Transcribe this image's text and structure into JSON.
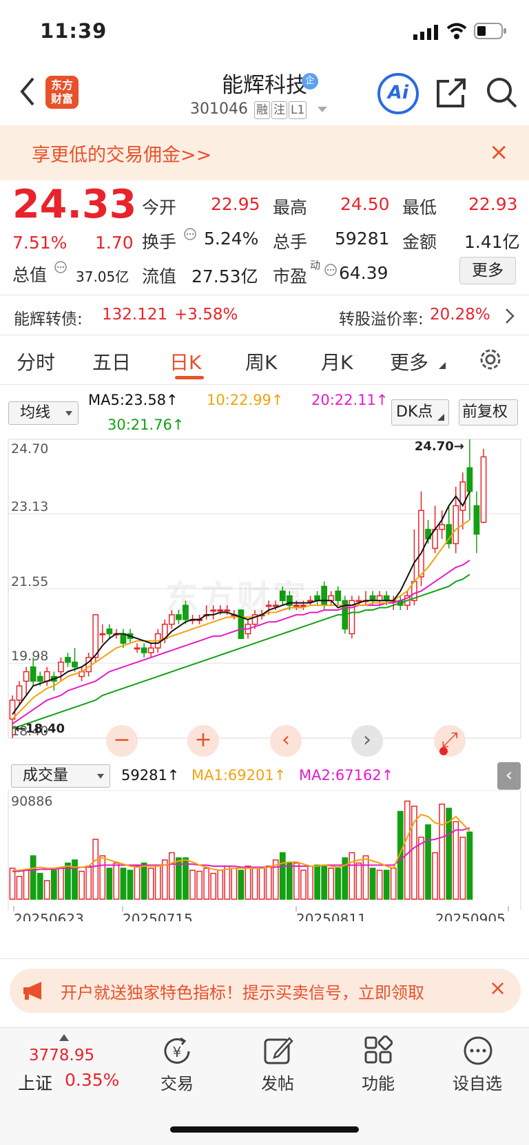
{
  "status": {
    "time": "11:39"
  },
  "nav": {
    "logo_line1": "东方",
    "logo_line2": "财富",
    "stock_name": "能辉科技",
    "badge": "企",
    "code": "301046",
    "tags": [
      "融",
      "注",
      "L1"
    ],
    "ai_label": "Ai"
  },
  "promo": {
    "text": "享更低的交易佣金>>",
    "close": "×"
  },
  "quote": {
    "price": "24.33",
    "change_pct": "7.51%",
    "change": "1.70",
    "open_label": "今开",
    "open": "22.95",
    "high_label": "最高",
    "high": "24.50",
    "low_label": "最低",
    "low": "22.93",
    "turnover_label": "换手",
    "turnover": "5.24%",
    "volume_label": "总手",
    "volume": "59281",
    "amount_label": "金额",
    "amount": "1.41亿",
    "mktcap_label": "总值",
    "mktcap": "37.05亿",
    "float_label": "流值",
    "float": "27.53亿",
    "pe_label": "市盈",
    "pe_sup": "动",
    "pe": "64.39",
    "more": "更多"
  },
  "bond": {
    "label": "能辉转债:",
    "price": "132.121",
    "change": "+3.58%",
    "premium_label": "转股溢价率:",
    "premium": "20.28%"
  },
  "tabs": [
    "分时",
    "五日",
    "日K",
    "周K",
    "月K",
    "更多"
  ],
  "ma_bar": {
    "selector": "均线",
    "ma5": "MA5:23.58↑",
    "ma10": "10:22.99↑",
    "ma20": "20:22.11↑",
    "ma30": "30:21.76↑",
    "dk": "DK点",
    "adjust": "前复权"
  },
  "kline": {
    "y_labels": [
      "24.70",
      "23.13",
      "21.55",
      "19.98",
      "18.40"
    ],
    "max_tag": "24.70→",
    "min_tag": "←18.40",
    "watermark": "东方财富"
  },
  "volume_bar": {
    "selector": "成交量",
    "vol": "59281↑",
    "ma1": "MA1:69201↑",
    "ma2": "MA2:67162↑",
    "max": "90886"
  },
  "dates": [
    "20250623",
    "20250715",
    "20250811",
    "20250905"
  ],
  "banner": {
    "text": "开户就送独家特色指标！提示买卖信号，立即领取",
    "close": "×"
  },
  "bottom": {
    "index_value": "3778.95",
    "index_name": "上证",
    "index_change": "0.35%",
    "items": [
      "交易",
      "发帖",
      "功能",
      "设自选"
    ]
  },
  "colors": {
    "up": "#e8232b",
    "down": "#13a013",
    "accent": "#e8512b",
    "ma5": "#111111",
    "ma10": "#f2a20d",
    "ma20": "#e31bc9",
    "ma30": "#13a013"
  },
  "chart_data": {
    "type": "candlestick",
    "price_range": [
      18.4,
      24.7
    ],
    "volume_max": 90886,
    "candles": [
      {
        "o": 18.8,
        "c": 19.2,
        "h": 19.3,
        "l": 18.4
      },
      {
        "o": 19.2,
        "c": 19.5,
        "h": 19.6,
        "l": 19.1
      },
      {
        "o": 19.6,
        "c": 19.8,
        "h": 19.9,
        "l": 19.3
      },
      {
        "o": 19.9,
        "c": 19.6,
        "h": 20.1,
        "l": 19.5
      },
      {
        "o": 19.7,
        "c": 19.6,
        "h": 19.8,
        "l": 19.5
      },
      {
        "o": 19.6,
        "c": 19.8,
        "h": 19.9,
        "l": 19.5
      },
      {
        "o": 19.7,
        "c": 19.6,
        "h": 19.8,
        "l": 19.4
      },
      {
        "o": 19.8,
        "c": 20.0,
        "h": 20.1,
        "l": 19.6
      },
      {
        "o": 20.1,
        "c": 20.0,
        "h": 20.2,
        "l": 19.9
      },
      {
        "o": 20.0,
        "c": 19.9,
        "h": 20.3,
        "l": 19.8
      },
      {
        "o": 19.7,
        "c": 19.8,
        "h": 19.9,
        "l": 19.6
      },
      {
        "o": 19.8,
        "c": 20.1,
        "h": 20.2,
        "l": 19.7
      },
      {
        "o": 20.1,
        "c": 21.0,
        "h": 21.0,
        "l": 20.0
      },
      {
        "o": 20.6,
        "c": 20.6,
        "h": 20.8,
        "l": 20.4
      },
      {
        "o": 20.7,
        "c": 20.6,
        "h": 20.8,
        "l": 20.5
      },
      {
        "o": 20.6,
        "c": 20.6,
        "h": 20.7,
        "l": 20.5
      },
      {
        "o": 20.6,
        "c": 20.4,
        "h": 20.7,
        "l": 20.3
      },
      {
        "o": 20.6,
        "c": 20.5,
        "h": 20.7,
        "l": 20.4
      },
      {
        "o": 20.3,
        "c": 20.3,
        "h": 20.4,
        "l": 20.2
      },
      {
        "o": 20.3,
        "c": 20.2,
        "h": 20.4,
        "l": 20.1
      },
      {
        "o": 20.2,
        "c": 20.3,
        "h": 20.4,
        "l": 20.1
      },
      {
        "o": 20.3,
        "c": 20.6,
        "h": 20.7,
        "l": 20.2
      },
      {
        "o": 20.5,
        "c": 20.8,
        "h": 20.9,
        "l": 20.4
      },
      {
        "o": 20.8,
        "c": 21.0,
        "h": 21.1,
        "l": 20.7
      },
      {
        "o": 21.0,
        "c": 20.9,
        "h": 21.1,
        "l": 20.8
      },
      {
        "o": 21.2,
        "c": 20.9,
        "h": 21.3,
        "l": 20.8
      },
      {
        "o": 20.9,
        "c": 20.9,
        "h": 21.0,
        "l": 20.8
      },
      {
        "o": 20.9,
        "c": 20.9,
        "h": 21.0,
        "l": 20.8
      },
      {
        "o": 21.0,
        "c": 21.0,
        "h": 21.2,
        "l": 20.9
      },
      {
        "o": 21.1,
        "c": 21.1,
        "h": 21.2,
        "l": 20.9
      },
      {
        "o": 21.1,
        "c": 21.1,
        "h": 21.2,
        "l": 21.0
      },
      {
        "o": 21.1,
        "c": 21.1,
        "h": 21.2,
        "l": 21.0
      },
      {
        "o": 21.0,
        "c": 21.0,
        "h": 21.1,
        "l": 20.9
      },
      {
        "o": 21.1,
        "c": 20.5,
        "h": 21.1,
        "l": 20.5
      },
      {
        "o": 20.6,
        "c": 20.8,
        "h": 20.9,
        "l": 20.5
      },
      {
        "o": 20.8,
        "c": 21.0,
        "h": 21.1,
        "l": 20.7
      },
      {
        "o": 21.0,
        "c": 21.0,
        "h": 21.1,
        "l": 20.9
      },
      {
        "o": 21.2,
        "c": 21.2,
        "h": 21.3,
        "l": 21.0
      },
      {
        "o": 21.2,
        "c": 21.2,
        "h": 21.3,
        "l": 21.1
      },
      {
        "o": 21.5,
        "c": 21.3,
        "h": 21.6,
        "l": 21.2
      },
      {
        "o": 21.4,
        "c": 21.2,
        "h": 21.5,
        "l": 21.1
      },
      {
        "o": 21.2,
        "c": 21.2,
        "h": 21.3,
        "l": 21.1
      },
      {
        "o": 21.2,
        "c": 21.2,
        "h": 21.3,
        "l": 21.1
      },
      {
        "o": 21.3,
        "c": 21.3,
        "h": 21.4,
        "l": 21.2
      },
      {
        "o": 21.4,
        "c": 21.3,
        "h": 21.5,
        "l": 21.2
      },
      {
        "o": 21.6,
        "c": 21.2,
        "h": 21.7,
        "l": 21.1
      },
      {
        "o": 21.3,
        "c": 21.4,
        "h": 21.5,
        "l": 21.2
      },
      {
        "o": 21.5,
        "c": 21.3,
        "h": 21.6,
        "l": 21.2
      },
      {
        "o": 21.3,
        "c": 20.7,
        "h": 21.4,
        "l": 20.6
      },
      {
        "o": 20.6,
        "c": 21.3,
        "h": 21.4,
        "l": 20.5
      },
      {
        "o": 21.3,
        "c": 21.3,
        "h": 21.4,
        "l": 21.2
      },
      {
        "o": 21.3,
        "c": 21.3,
        "h": 21.5,
        "l": 21.2
      },
      {
        "o": 21.4,
        "c": 21.3,
        "h": 21.5,
        "l": 21.2
      },
      {
        "o": 21.3,
        "c": 21.4,
        "h": 21.5,
        "l": 21.2
      },
      {
        "o": 21.4,
        "c": 21.3,
        "h": 21.5,
        "l": 21.2
      },
      {
        "o": 21.3,
        "c": 21.3,
        "h": 21.4,
        "l": 21.1
      },
      {
        "o": 21.3,
        "c": 21.2,
        "h": 21.4,
        "l": 21.1
      },
      {
        "o": 21.2,
        "c": 21.4,
        "h": 21.5,
        "l": 21.1
      },
      {
        "o": 21.3,
        "c": 21.7,
        "h": 22.8,
        "l": 21.2
      },
      {
        "o": 21.8,
        "c": 23.2,
        "h": 23.6,
        "l": 21.6
      },
      {
        "o": 22.8,
        "c": 22.6,
        "h": 23.0,
        "l": 22.5
      },
      {
        "o": 22.4,
        "c": 22.8,
        "h": 23.3,
        "l": 22.3
      },
      {
        "o": 22.8,
        "c": 22.9,
        "h": 23.2,
        "l": 22.6
      },
      {
        "o": 22.9,
        "c": 22.5,
        "h": 23.3,
        "l": 22.4
      },
      {
        "o": 22.5,
        "c": 23.3,
        "h": 23.7,
        "l": 22.3
      },
      {
        "o": 23.2,
        "c": 23.8,
        "h": 24.0,
        "l": 22.8
      },
      {
        "o": 24.1,
        "c": 23.6,
        "h": 24.7,
        "l": 23.0
      },
      {
        "o": 23.3,
        "c": 22.7,
        "h": 23.6,
        "l": 22.3
      },
      {
        "o": 22.95,
        "c": 24.33,
        "h": 24.5,
        "l": 22.93
      }
    ],
    "volumes": [
      30,
      22,
      28,
      42,
      25,
      18,
      28,
      30,
      35,
      38,
      27,
      32,
      58,
      42,
      30,
      35,
      30,
      28,
      32,
      35,
      30,
      33,
      38,
      45,
      40,
      40,
      28,
      27,
      30,
      25,
      28,
      32,
      30,
      28,
      32,
      30,
      30,
      32,
      38,
      45,
      35,
      35,
      28,
      32,
      33,
      33,
      30,
      30,
      40,
      45,
      35,
      42,
      30,
      28,
      28,
      30,
      85,
      95,
      90,
      60,
      72,
      45,
      92,
      88,
      75,
      60,
      65
    ],
    "ma5": [
      18.9,
      19.1,
      19.3,
      19.5,
      19.55,
      19.6,
      19.65,
      19.7,
      19.8,
      19.85,
      19.9,
      20.0,
      20.15,
      20.35,
      20.5,
      20.6,
      20.6,
      20.55,
      20.5,
      20.45,
      20.4,
      20.4,
      20.5,
      20.65,
      20.75,
      20.85,
      20.9,
      20.9,
      21.0,
      21.0,
      21.05,
      21.05,
      21.0,
      20.95,
      20.9,
      20.95,
      21.0,
      21.1,
      21.15,
      21.2,
      21.25,
      21.25,
      21.25,
      21.25,
      21.3,
      21.3,
      21.3,
      21.15,
      21.2,
      21.2,
      21.25,
      21.3,
      21.3,
      21.3,
      21.3,
      21.3,
      21.5,
      21.8,
      22.1,
      22.3,
      22.6,
      22.8,
      23.0,
      23.3,
      23.5,
      23.3,
      23.6
    ],
    "ma10": [
      18.8,
      18.95,
      19.1,
      19.25,
      19.35,
      19.45,
      19.5,
      19.6,
      19.7,
      19.75,
      19.8,
      19.9,
      20.0,
      20.1,
      20.2,
      20.3,
      20.35,
      20.4,
      20.45,
      20.45,
      20.45,
      20.45,
      20.5,
      20.55,
      20.6,
      20.65,
      20.7,
      20.75,
      20.8,
      20.85,
      20.9,
      20.95,
      20.95,
      20.95,
      20.95,
      20.95,
      21.0,
      21.05,
      21.05,
      21.1,
      21.15,
      21.15,
      21.15,
      21.2,
      21.2,
      21.2,
      21.2,
      21.2,
      21.2,
      21.2,
      21.2,
      21.2,
      21.25,
      21.25,
      21.25,
      21.3,
      21.4,
      21.5,
      21.7,
      21.85,
      22.0,
      22.2,
      22.4,
      22.6,
      22.8,
      22.9,
      23.0
    ],
    "ma20": [
      18.7,
      18.8,
      18.9,
      19.0,
      19.1,
      19.2,
      19.25,
      19.3,
      19.4,
      19.45,
      19.5,
      19.55,
      19.6,
      19.7,
      19.8,
      19.85,
      19.9,
      19.95,
      20.0,
      20.05,
      20.1,
      20.15,
      20.2,
      20.25,
      20.3,
      20.35,
      20.4,
      20.45,
      20.5,
      20.55,
      20.55,
      20.6,
      20.65,
      20.7,
      20.7,
      20.75,
      20.8,
      20.85,
      20.85,
      20.9,
      20.95,
      21.0,
      21.0,
      21.05,
      21.05,
      21.1,
      21.1,
      21.1,
      21.15,
      21.15,
      21.2,
      21.2,
      21.2,
      21.2,
      21.25,
      21.25,
      21.3,
      21.35,
      21.45,
      21.5,
      21.6,
      21.7,
      21.8,
      21.9,
      22.0,
      22.05,
      22.15
    ],
    "ma30": [
      18.6,
      18.65,
      18.7,
      18.75,
      18.8,
      18.85,
      18.9,
      18.95,
      19.0,
      19.05,
      19.1,
      19.15,
      19.2,
      19.3,
      19.35,
      19.4,
      19.45,
      19.5,
      19.55,
      19.6,
      19.65,
      19.7,
      19.75,
      19.8,
      19.85,
      19.9,
      19.95,
      20.0,
      20.05,
      20.1,
      20.15,
      20.2,
      20.25,
      20.3,
      20.35,
      20.4,
      20.45,
      20.5,
      20.55,
      20.6,
      20.65,
      20.7,
      20.75,
      20.8,
      20.85,
      20.9,
      20.95,
      21.0,
      21.0,
      21.05,
      21.05,
      21.1,
      21.1,
      21.15,
      21.15,
      21.2,
      21.25,
      21.3,
      21.35,
      21.4,
      21.45,
      21.5,
      21.55,
      21.6,
      21.7,
      21.75,
      21.85
    ],
    "vol_ma1": [
      28,
      28,
      29,
      30,
      31,
      30,
      30,
      31,
      32,
      31,
      31,
      32,
      38,
      40,
      38,
      36,
      34,
      32,
      31,
      32,
      32,
      32,
      33,
      35,
      37,
      38,
      36,
      33,
      31,
      29,
      28,
      29,
      30,
      30,
      30,
      30,
      30,
      31,
      33,
      35,
      36,
      36,
      34,
      32,
      32,
      33,
      32,
      31,
      33,
      36,
      38,
      39,
      37,
      35,
      32,
      30,
      45,
      60,
      75,
      82,
      80,
      74,
      72,
      75,
      80,
      73,
      66
    ],
    "vol_ma2": [
      27,
      27,
      28,
      28,
      29,
      29,
      29,
      30,
      30,
      30,
      31,
      31,
      32,
      33,
      33,
      33,
      33,
      33,
      33,
      33,
      33,
      33,
      33,
      34,
      34,
      34,
      34,
      33,
      33,
      32,
      32,
      32,
      32,
      31,
      31,
      31,
      31,
      31,
      31,
      32,
      32,
      32,
      32,
      32,
      32,
      33,
      33,
      33,
      33,
      33,
      33,
      33,
      33,
      33,
      33,
      33,
      38,
      44,
      50,
      54,
      57,
      58,
      60,
      63,
      67,
      67,
      69
    ]
  }
}
